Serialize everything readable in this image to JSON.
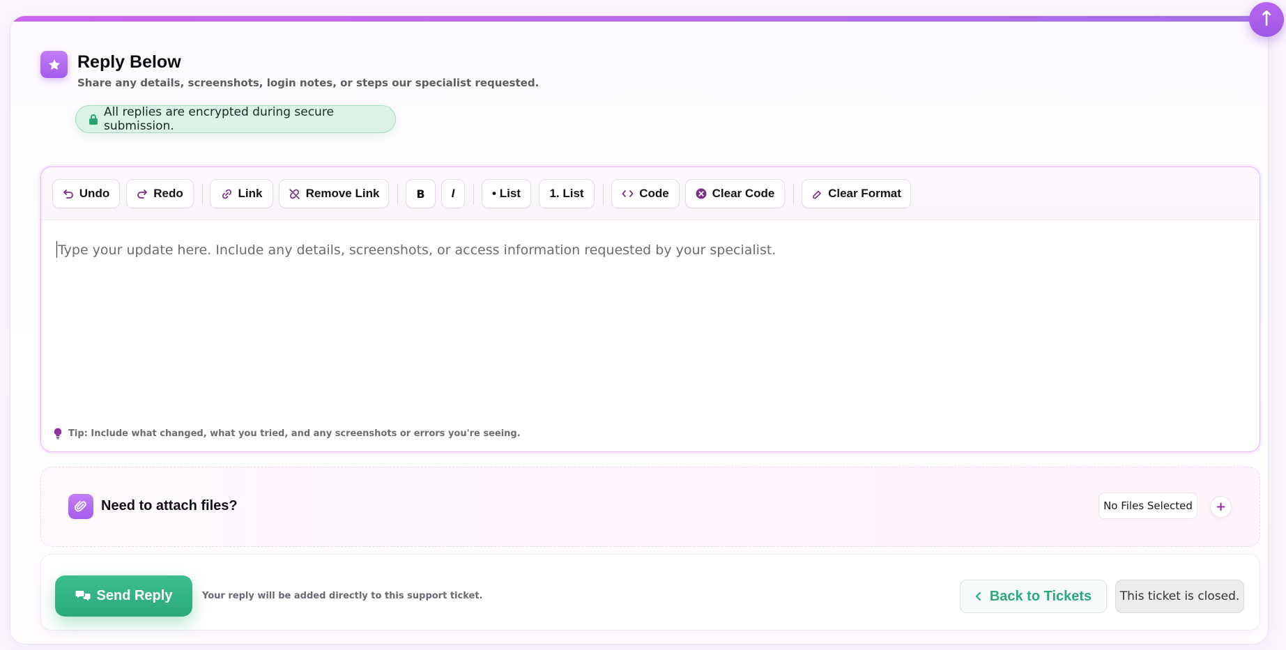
{
  "header": {
    "title": "Reply Below",
    "subtitle": "Share any details, screenshots, login notes, or steps our specialist requested.",
    "secure_notice": "All replies are encrypted during secure submission."
  },
  "toolbar": {
    "undo": "Undo",
    "redo": "Redo",
    "link": "Link",
    "remove_link": "Remove Link",
    "bold": "B",
    "italic": "I",
    "bullet_list": "• List",
    "numbered_list": "1. List",
    "code": "Code",
    "clear_code": "Clear Code",
    "clear_format": "Clear Format"
  },
  "editor": {
    "placeholder": "Type your update here. Include any details, screenshots, or access information requested by your specialist.",
    "tip": "Tip: Include what changed, what you tried, and any screenshots or errors you're seeing."
  },
  "attachments": {
    "title": "Need to attach files?",
    "status": "No Files Selected",
    "add_label": "+"
  },
  "actions": {
    "send_label": "Send Reply",
    "send_note": "Your reply will be added directly to this support ticket.",
    "back_label": "Back to Tickets",
    "closed_label": "This ticket is closed."
  },
  "scroll_top": {
    "label": "↑"
  },
  "colors": {
    "accent_purple": "#a35ceb",
    "accent_green": "#2aa979",
    "secure_bg": "#d9f3e5"
  }
}
